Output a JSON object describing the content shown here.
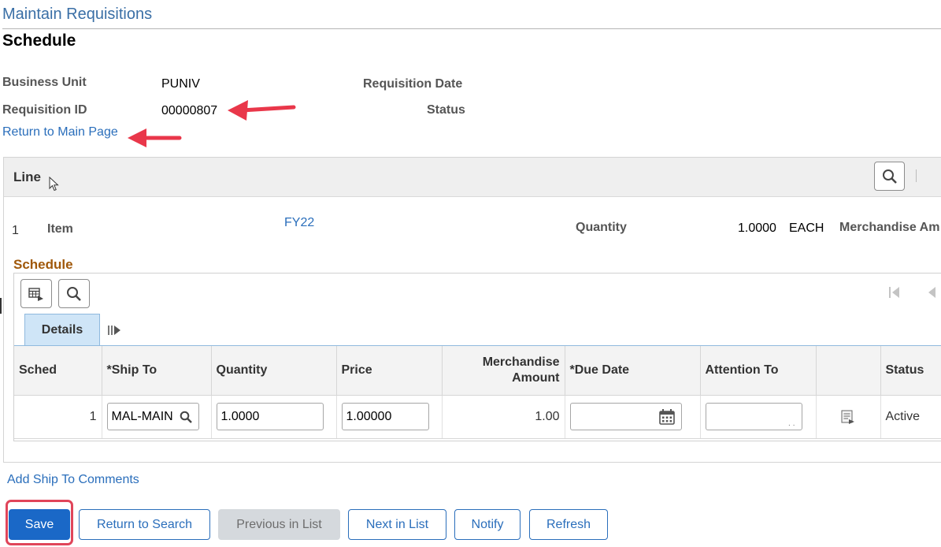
{
  "page": {
    "heading": "Maintain Requisitions",
    "section_title": "Schedule"
  },
  "header_fields": {
    "business_unit_label": "Business Unit",
    "business_unit_value": "PUNIV",
    "requisition_date_label": "Requisition Date",
    "requisition_id_label": "Requisition ID",
    "requisition_id_value": "00000807",
    "status_label": "Status",
    "return_to_main_link": "Return to Main Page"
  },
  "line": {
    "title": "Line",
    "number": "1",
    "item_label": "Item",
    "item_value": "FY22",
    "quantity_label": "Quantity",
    "quantity_value": "1.0000",
    "uom": "EACH",
    "merch_amount_label": "Merchandise Am"
  },
  "schedule": {
    "title": "Schedule",
    "tabs": [
      {
        "label": "Details",
        "active": true
      }
    ],
    "columns": [
      "Sched",
      "*Ship To",
      "Quantity",
      "Price",
      "Merchandise Amount",
      "*Due Date",
      "Attention To",
      "",
      "Status"
    ],
    "merch_header_line1": "Merchandise",
    "merch_header_line2": "Amount",
    "rows": [
      {
        "sched": "1",
        "ship_to": "MAL-MAIN",
        "quantity": "1.0000",
        "price": "1.00000",
        "merchandise_amount": "1.00",
        "due_date": "",
        "attention_to": "",
        "status": "Active"
      }
    ]
  },
  "links": {
    "add_ship_to_comments": "Add Ship To Comments"
  },
  "buttons": {
    "save": "Save",
    "return_to_search": "Return to Search",
    "previous_in_list": "Previous in List",
    "next_in_list": "Next in List",
    "notify": "Notify",
    "refresh": "Refresh"
  },
  "colors": {
    "accent_blue": "#1a68c7",
    "link_blue": "#2a6ebb",
    "heading_blue": "#3a6fa6",
    "schedule_title": "#a0580a",
    "annotation_red": "#e0455a"
  },
  "icons": [
    "search-icon",
    "grid-personalize-icon",
    "show-all-columns-icon",
    "first-page-icon",
    "previous-page-icon",
    "calendar-icon",
    "row-details-icon",
    "mouse-cursor-icon"
  ]
}
